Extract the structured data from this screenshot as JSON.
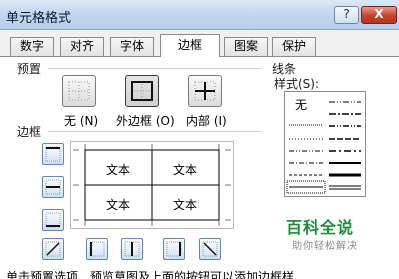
{
  "window": {
    "title": "单元格格式",
    "help_label": "?",
    "close_label": "X"
  },
  "tabs": [
    {
      "label": "数字"
    },
    {
      "label": "对齐"
    },
    {
      "label": "字体"
    },
    {
      "label": "边框",
      "active": true
    },
    {
      "label": "图案"
    },
    {
      "label": "保护"
    }
  ],
  "presets": {
    "group_label": "预置",
    "items": [
      {
        "label": "无 (N)",
        "icon": "no-border-icon"
      },
      {
        "label": "外边框 (O)",
        "icon": "outline-border-icon"
      },
      {
        "label": "内部 (I)",
        "icon": "inside-border-icon"
      }
    ]
  },
  "border": {
    "group_label": "边框",
    "preview_cells": [
      "文本",
      "文本",
      "文本",
      "文本"
    ],
    "side_buttons": [
      "top-border-icon",
      "middle-horizontal-border-icon",
      "bottom-border-icon",
      "diagonal-up-border-icon",
      "left-border-icon",
      "middle-vertical-border-icon",
      "right-border-icon",
      "diagonal-down-border-icon"
    ]
  },
  "line": {
    "group_label": "线条",
    "style_label": "样式(S):",
    "none_label": "无",
    "styles": [
      "none",
      "dash-dot-dot",
      "dashed-dot",
      "dotted",
      "dash-dot",
      "dash-dot-dot-medium",
      "dashed-medium",
      "dashed",
      "thick",
      "thin",
      "medium",
      "double"
    ]
  },
  "watermark": {
    "main": "百科全说",
    "sub": "助你轻松解决"
  },
  "footer": {
    "note": "单击预置选项、预览草图及上面的按钮可以添加边框样"
  }
}
